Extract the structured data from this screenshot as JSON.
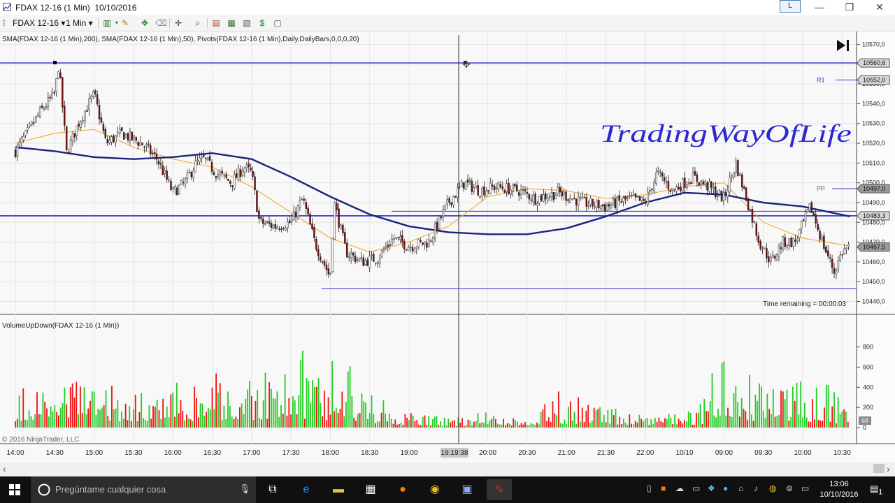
{
  "window": {
    "title": "FDAX 12-16 (1 Min)  10/10/2016",
    "layout_button": "L",
    "minimize": "—",
    "maximize": "❐",
    "close": "✕"
  },
  "toolbar": {
    "instrument": "FDAX 12-16",
    "interval": "1 Min",
    "icons": [
      "bar-chart-icon",
      "draw-pencil-icon",
      "properties-icon",
      "eraser-icon",
      "crosshair-icon",
      "zoom-icon",
      "strategy-icon",
      "indicator-icon",
      "template-icon",
      "money-icon",
      "data-box-icon"
    ]
  },
  "chart": {
    "indicator_label": "SMA(FDAX 12-16 (1 Min),200), SMA(FDAX 12-16 (1 Min),50), Pivots(FDAX 12-16 (1 Min),Daily,DailyBars,0,0,0,20)",
    "volume_label": "VolumeUpDown(FDAX 12-16 (1 Min))",
    "watermark": "TradingWayOfLife",
    "time_remaining": "Time remaining = 00:00:03",
    "copyright": "© 2016 NinjaTrader, LLC",
    "crosshair_time": "19:19:38",
    "pivot_labels": {
      "r1": "R1",
      "pp": "PP"
    },
    "colors": {
      "sma200": "#1a237e",
      "sma50": "#f0b040",
      "pivot": "#2a2ad0",
      "up": "#22cc22",
      "down": "#ee1111",
      "candle": "#222222"
    }
  },
  "chart_data": {
    "type": "line",
    "price_axis": {
      "ticks": [
        "10570,0",
        "10560,0",
        "10550,0",
        "10540,0",
        "10530,0",
        "10520,0",
        "10510,0",
        "10500,0",
        "10490,0",
        "10480,0",
        "10470,0",
        "10460,0",
        "10450,0",
        "10440,0"
      ],
      "ylim": [
        10437,
        10573
      ],
      "markers": {
        "top_line": "10560,6",
        "r1": "10552,0",
        "pp": "10497,0",
        "s_line": "10483,3",
        "last": "10467,5"
      },
      "marker_values": {
        "top_line": 10560.6,
        "r1": 10552.0,
        "pp": 10497.0,
        "s_line": 10483.3,
        "last": 10467.5,
        "bottom_line": 10446.5
      }
    },
    "time_axis": {
      "ticks": [
        "14:00",
        "14:30",
        "15:00",
        "15:30",
        "16:00",
        "16:30",
        "17:00",
        "17:30",
        "18:00",
        "18:30",
        "19:00",
        "20:00",
        "20:30",
        "21:00",
        "21:30",
        "22:00",
        "10/10",
        "09:00",
        "09:30",
        "10:00",
        "10:30"
      ],
      "tick_positions": [
        0,
        1,
        2,
        3,
        4,
        5,
        6,
        7,
        8,
        9,
        10,
        12,
        13,
        14,
        15,
        16,
        17,
        18,
        19,
        20,
        21
      ]
    },
    "price_path": [
      [
        0,
        10516
      ],
      [
        0.3,
        10525
      ],
      [
        0.6,
        10535
      ],
      [
        1.0,
        10545
      ],
      [
        1.1,
        10560
      ],
      [
        1.3,
        10515
      ],
      [
        1.6,
        10530
      ],
      [
        2.0,
        10545
      ],
      [
        2.3,
        10520
      ],
      [
        2.7,
        10525
      ],
      [
        3.2,
        10520
      ],
      [
        3.6,
        10512
      ],
      [
        4.0,
        10495
      ],
      [
        4.3,
        10500
      ],
      [
        4.6,
        10510
      ],
      [
        4.8,
        10512
      ],
      [
        5.1,
        10505
      ],
      [
        5.5,
        10500
      ],
      [
        5.8,
        10508
      ],
      [
        6.0,
        10505
      ],
      [
        6.2,
        10480
      ],
      [
        6.6,
        10478
      ],
      [
        7.0,
        10480
      ],
      [
        7.3,
        10492
      ],
      [
        7.6,
        10470
      ],
      [
        8.0,
        10452
      ],
      [
        8.1,
        10490
      ],
      [
        8.4,
        10465
      ],
      [
        8.8,
        10460
      ],
      [
        9.2,
        10462
      ],
      [
        9.6,
        10472
      ],
      [
        10.0,
        10468
      ],
      [
        10.5,
        10470
      ],
      [
        11.0,
        10490
      ],
      [
        11.4,
        10500
      ],
      [
        11.8,
        10496
      ],
      [
        12.2,
        10498
      ],
      [
        12.8,
        10496
      ],
      [
        13.2,
        10492
      ],
      [
        13.8,
        10495
      ],
      [
        14.4,
        10490
      ],
      [
        15.0,
        10488
      ],
      [
        15.6,
        10492
      ],
      [
        16.0,
        10490
      ],
      [
        16.3,
        10505
      ],
      [
        16.7,
        10496
      ],
      [
        17.2,
        10503
      ],
      [
        17.6,
        10498
      ],
      [
        18.0,
        10492
      ],
      [
        18.3,
        10510
      ],
      [
        18.6,
        10490
      ],
      [
        18.9,
        10470
      ],
      [
        19.2,
        10460
      ],
      [
        19.5,
        10470
      ],
      [
        19.8,
        10470
      ],
      [
        20.2,
        10488
      ],
      [
        20.5,
        10470
      ],
      [
        20.8,
        10455
      ],
      [
        21.0,
        10465
      ],
      [
        21.2,
        10468
      ]
    ],
    "sma200_path": [
      [
        0,
        10518
      ],
      [
        1,
        10516
      ],
      [
        2,
        10513
      ],
      [
        3,
        10512
      ],
      [
        4,
        10513
      ],
      [
        5,
        10515
      ],
      [
        6,
        10512
      ],
      [
        7,
        10503
      ],
      [
        8,
        10493
      ],
      [
        9,
        10484
      ],
      [
        10,
        10478
      ],
      [
        11,
        10475
      ],
      [
        12,
        10474
      ],
      [
        13,
        10474
      ],
      [
        14,
        10477
      ],
      [
        15,
        10483
      ],
      [
        16,
        10490
      ],
      [
        17,
        10495
      ],
      [
        18,
        10494
      ],
      [
        19,
        10490
      ],
      [
        20,
        10488
      ],
      [
        21.2,
        10483
      ]
    ],
    "sma50_path": [
      [
        0,
        10520
      ],
      [
        1,
        10525
      ],
      [
        2,
        10527
      ],
      [
        3,
        10518
      ],
      [
        4,
        10512
      ],
      [
        5,
        10508
      ],
      [
        6,
        10498
      ],
      [
        7,
        10485
      ],
      [
        8,
        10472
      ],
      [
        9,
        10465
      ],
      [
        10,
        10470
      ],
      [
        11,
        10478
      ],
      [
        12,
        10493
      ],
      [
        13,
        10497
      ],
      [
        14,
        10496
      ],
      [
        15,
        10492
      ],
      [
        16,
        10494
      ],
      [
        17,
        10498
      ],
      [
        18,
        10500
      ],
      [
        19,
        10480
      ],
      [
        20,
        10472
      ],
      [
        21.2,
        10468
      ]
    ],
    "volume_axis": {
      "ticks": [
        800,
        600,
        400,
        200,
        0
      ],
      "ylim": [
        0,
        950
      ],
      "last": "68"
    },
    "volume_profile": {
      "max_down_series": [
        [
          0,
          380
        ],
        [
          1,
          490
        ],
        [
          2,
          560
        ],
        [
          3,
          410
        ],
        [
          4,
          380
        ],
        [
          5,
          560
        ],
        [
          6,
          560
        ],
        [
          7,
          420
        ],
        [
          8,
          510
        ],
        [
          9,
          280
        ],
        [
          10,
          150
        ],
        [
          11,
          90
        ],
        [
          12,
          110
        ],
        [
          13,
          90
        ],
        [
          14,
          430
        ],
        [
          15,
          200
        ],
        [
          16,
          90
        ],
        [
          17,
          120
        ],
        [
          18,
          360
        ],
        [
          19,
          460
        ],
        [
          20,
          310
        ],
        [
          21.2,
          230
        ]
      ],
      "max_up_series": [
        [
          0,
          420
        ],
        [
          1,
          560
        ],
        [
          2,
          420
        ],
        [
          3,
          410
        ],
        [
          4,
          490
        ],
        [
          5,
          350
        ],
        [
          6,
          500
        ],
        [
          7,
          740
        ],
        [
          8,
          920
        ],
        [
          9,
          360
        ],
        [
          10,
          200
        ],
        [
          11,
          100
        ],
        [
          12,
          170
        ],
        [
          13,
          160
        ],
        [
          14,
          210
        ],
        [
          15,
          250
        ],
        [
          16,
          110
        ],
        [
          17,
          170
        ],
        [
          18,
          720
        ],
        [
          19,
          560
        ],
        [
          20,
          470
        ],
        [
          21.2,
          480
        ]
      ]
    }
  },
  "scroll": {
    "left": "‹",
    "right": "›"
  },
  "taskbar": {
    "search_placeholder": "Pregúntame cualquier cosa",
    "time": "13:06",
    "date": "10/10/2016",
    "notifications": "1"
  }
}
